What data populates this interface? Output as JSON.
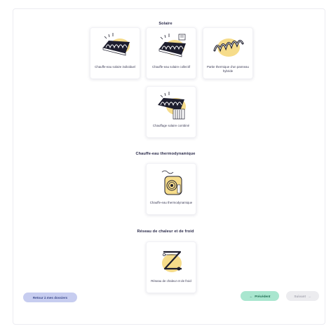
{
  "sections": {
    "solaire": {
      "title": "Solaire",
      "cards": [
        {
          "label": "Chauffe-eau solaire individuel",
          "icon": "solar-water-heater-individual-icon"
        },
        {
          "label": "Chauffe-eau solaire collectif",
          "icon": "solar-water-heater-collective-icon"
        },
        {
          "label": "Partie thermique d'un panneau hybride",
          "icon": "hybrid-panel-thermal-icon"
        },
        {
          "label": "Chauffage solaire combiné",
          "icon": "combined-solar-heating-icon"
        }
      ]
    },
    "thermo": {
      "title": "Chauffe-eau thermodynamique",
      "cards": [
        {
          "label": "Chauffe-eau thermodynamique",
          "icon": "thermodynamic-water-heater-icon"
        }
      ]
    },
    "reseau": {
      "title": "Réseau de chaleur et de froid",
      "cards": [
        {
          "label": "Réseau de chaleur et de froid",
          "icon": "heat-cold-network-icon"
        }
      ]
    }
  },
  "footer": {
    "back_label": "Retour à mes dossiers",
    "prev_label": "Précédent",
    "prev_arrow": "←",
    "next_label": "Suivant",
    "next_arrow": "→"
  },
  "colors": {
    "accent_yellow": "#f6dc8a",
    "panel_dark": "#1e1e2e",
    "back_button": "#c7cdf0",
    "prev_button": "#a9e6cf",
    "next_button_disabled": "#ececef"
  }
}
